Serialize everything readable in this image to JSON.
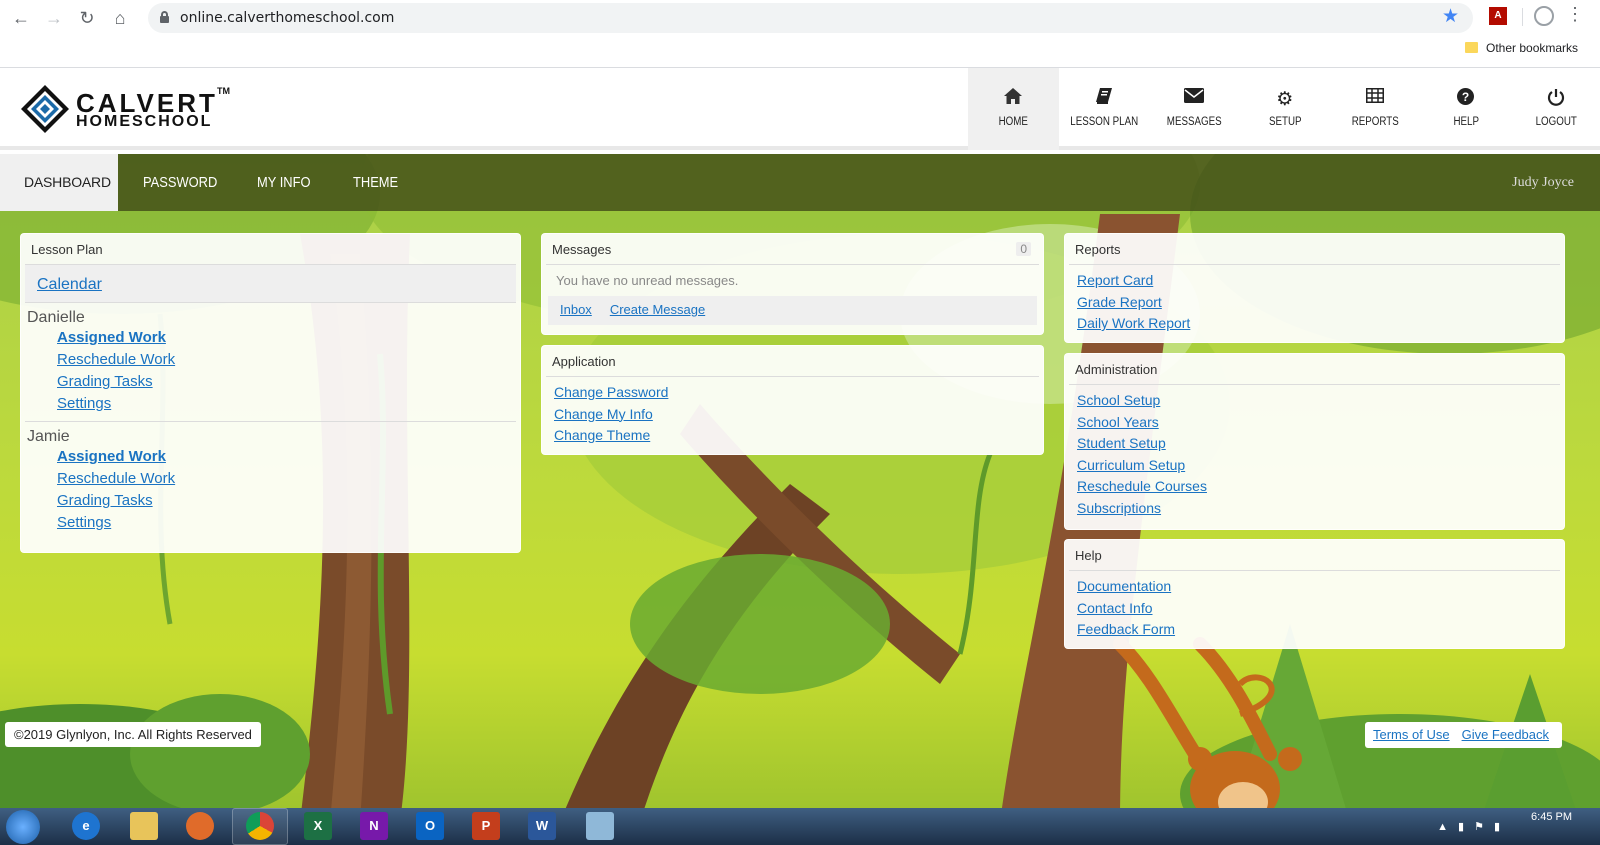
{
  "browser": {
    "url": "online.calverthomeschool.com",
    "other_bookmarks": "Other bookmarks"
  },
  "brand": {
    "line1": "CALVERT",
    "line2": "HOMESCHOOL",
    "tm": "TM"
  },
  "topnav": [
    {
      "label": "HOME",
      "icon": "home-icon"
    },
    {
      "label": "LESSON PLAN",
      "icon": "book-icon"
    },
    {
      "label": "MESSAGES",
      "icon": "envelope-icon"
    },
    {
      "label": "SETUP",
      "icon": "gear-icon"
    },
    {
      "label": "REPORTS",
      "icon": "table-icon"
    },
    {
      "label": "HELP",
      "icon": "question-icon"
    },
    {
      "label": "LOGOUT",
      "icon": "power-icon"
    }
  ],
  "subnav": {
    "tabs": [
      "DASHBOARD",
      "PASSWORD",
      "MY INFO",
      "THEME"
    ],
    "user": "Judy Joyce"
  },
  "lesson_plan": {
    "title": "Lesson Plan",
    "calendar": "Calendar",
    "students": [
      {
        "name": "Danielle",
        "links": [
          "Assigned Work",
          "Reschedule Work",
          "Grading Tasks",
          "Settings"
        ]
      },
      {
        "name": "Jamie",
        "links": [
          "Assigned Work",
          "Reschedule Work",
          "Grading Tasks",
          "Settings"
        ]
      }
    ]
  },
  "messages": {
    "title": "Messages",
    "count": "0",
    "empty_text": "You have no unread messages.",
    "inbox": "Inbox",
    "create": "Create Message"
  },
  "application": {
    "title": "Application",
    "links": [
      "Change Password",
      "Change My Info",
      "Change Theme"
    ]
  },
  "reports": {
    "title": "Reports",
    "links": [
      "Report Card",
      "Grade Report",
      "Daily Work Report"
    ]
  },
  "administration": {
    "title": "Administration",
    "links": [
      "School Setup",
      "School Years",
      "Student Setup",
      "Curriculum Setup",
      "Reschedule Courses",
      "Subscriptions"
    ]
  },
  "help": {
    "title": "Help",
    "links": [
      "Documentation",
      "Contact Info",
      "Feedback Form"
    ]
  },
  "footer": {
    "copyright": "©2019 Glynlyon, Inc. All Rights Reserved",
    "terms": "Terms of Use",
    "feedback": "Give Feedback"
  },
  "taskbar": {
    "time": "6:45 PM"
  },
  "colors": {
    "link": "#1a73c2",
    "subnav_bg": "#3e4616",
    "jungle_green": "#bcd93d"
  }
}
